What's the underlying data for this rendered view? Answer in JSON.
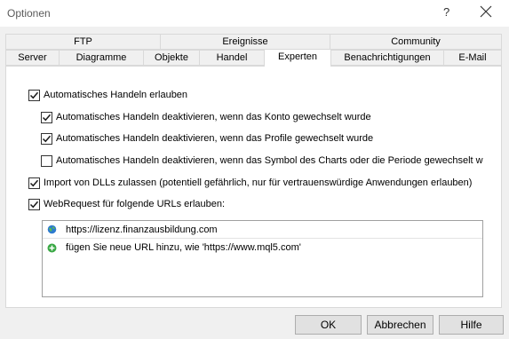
{
  "window": {
    "title": "Optionen",
    "help": "?"
  },
  "tabs_row1": [
    {
      "label": "FTP"
    },
    {
      "label": "Ereignisse"
    },
    {
      "label": "Community"
    }
  ],
  "tabs_row2": [
    {
      "label": "Server"
    },
    {
      "label": "Diagramme"
    },
    {
      "label": "Objekte"
    },
    {
      "label": "Handel"
    },
    {
      "label": "Experten",
      "active": true
    },
    {
      "label": "Benachrichtigungen"
    },
    {
      "label": "E-Mail"
    }
  ],
  "options": [
    {
      "label": "Automatisches Handeln erlauben",
      "checked": true
    },
    {
      "label": "Automatisches Handeln deaktivieren, wenn das Konto gewechselt wurde",
      "checked": true
    },
    {
      "label": "Automatisches Handeln deaktivieren, wenn das Profile gewechselt wurde",
      "checked": true
    },
    {
      "label": "Automatisches Handeln deaktivieren, wenn das Symbol des Charts oder die Periode gewechselt wurde",
      "checked": false
    },
    {
      "label": "Import von DLLs zulassen (potentiell gefährlich, nur für vertrauenswürdige Anwendungen erlauben)",
      "checked": true
    },
    {
      "label": "WebRequest für folgende URLs erlauben:",
      "checked": true
    }
  ],
  "url_list": {
    "items": [
      {
        "url": "https://lizenz.finanzausbildung.com",
        "icon": "globe-icon"
      }
    ],
    "add_hint": "fügen Sie neue URL hinzu, wie 'https://www.mql5.com'",
    "add_icon": "plus-circle-icon"
  },
  "buttons": {
    "ok": "OK",
    "cancel": "Abbrechen",
    "help": "Hilfe"
  },
  "colors": {
    "check_mark": "#1a1a1a",
    "globe": "#2e7bcf",
    "add": "#3aa845",
    "tab_border": "#d9d9d9"
  }
}
